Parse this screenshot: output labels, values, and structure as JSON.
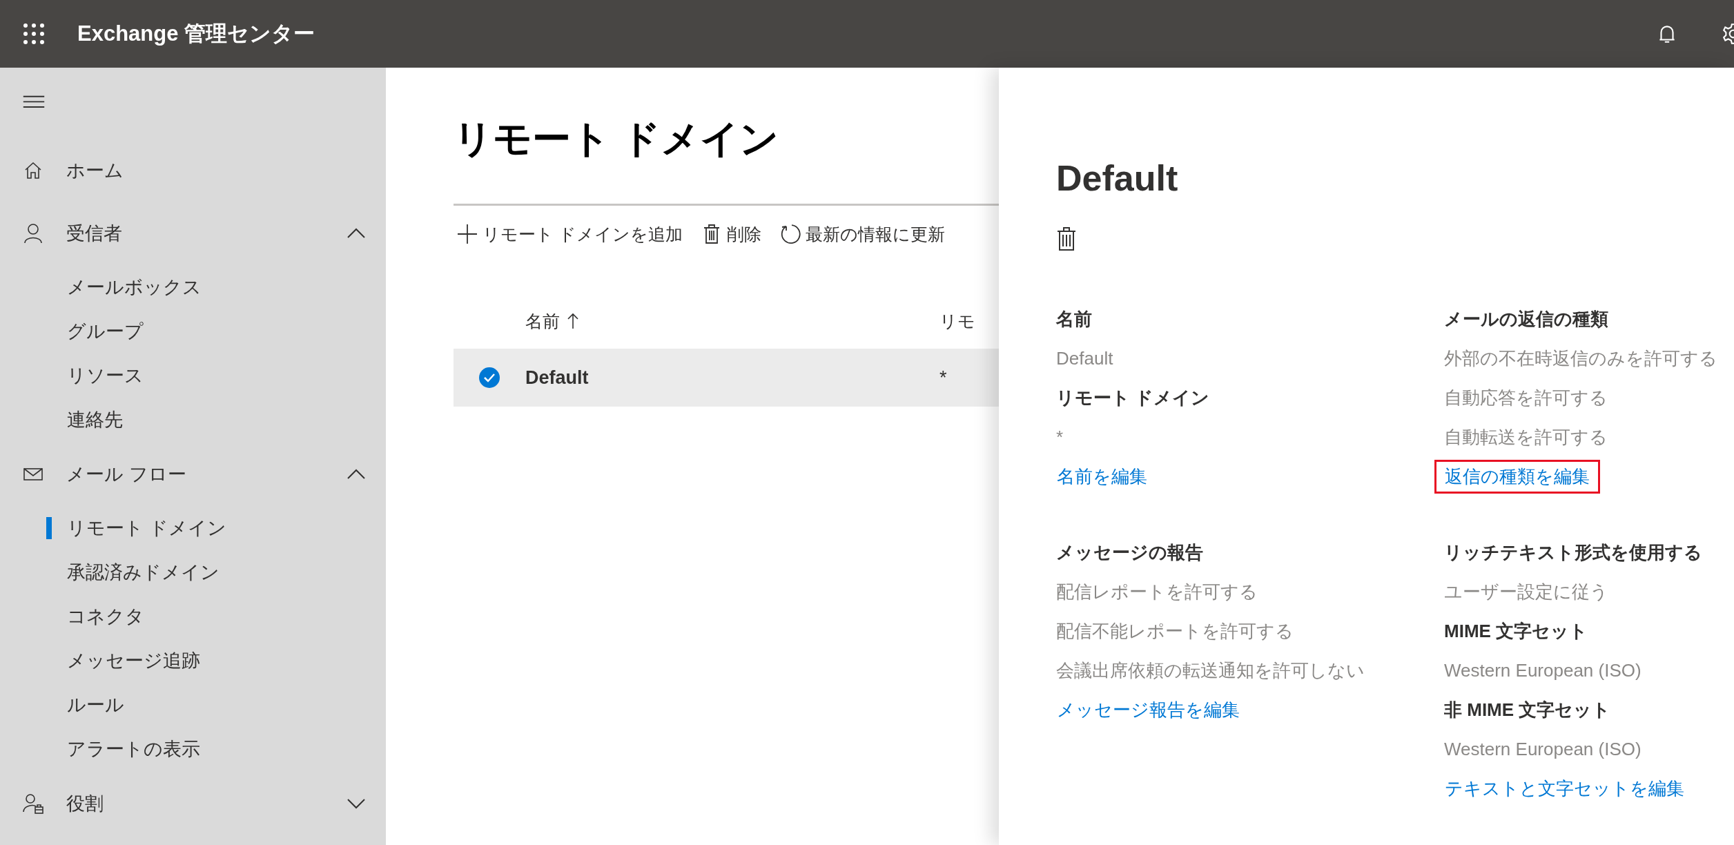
{
  "top_bar": {
    "title": "Exchange 管理センター"
  },
  "sidebar": {
    "items": [
      {
        "label": "ホーム",
        "selected": false
      },
      {
        "label": "受信者",
        "selected": false,
        "expanded": true,
        "children": [
          {
            "label": "メールボックス",
            "selected": false
          },
          {
            "label": "グループ",
            "selected": false
          },
          {
            "label": "リソース",
            "selected": false
          },
          {
            "label": "連絡先",
            "selected": false
          }
        ]
      },
      {
        "label": "メール フロー",
        "selected": false,
        "expanded": true,
        "children": [
          {
            "label": "リモート ドメイン",
            "selected": true
          },
          {
            "label": "承認済みドメイン",
            "selected": false
          },
          {
            "label": "コネクタ",
            "selected": false
          },
          {
            "label": "メッセージ追跡",
            "selected": false
          },
          {
            "label": "ルール",
            "selected": false
          },
          {
            "label": "アラートの表示",
            "selected": false
          }
        ]
      },
      {
        "label": "役割",
        "selected": false,
        "expanded": false
      }
    ]
  },
  "page": {
    "title": "リモート ドメイン",
    "toolbar": [
      "リモート ドメインを追加",
      "削除",
      "最新の情報に更新"
    ],
    "table": {
      "columns": [
        {
          "label": "名前",
          "sorted": true
        },
        {
          "label": "リモ",
          "sorted": false
        }
      ],
      "rows": [
        {
          "cells": [
            "Default",
            "*"
          ],
          "selected": true
        }
      ]
    }
  },
  "panel": {
    "title": "Default",
    "columns": [
      [
        {
          "kind": "heading",
          "text": "名前"
        },
        {
          "kind": "value",
          "text": "Default"
        },
        {
          "kind": "heading",
          "text": "リモート ドメイン"
        },
        {
          "kind": "value",
          "text": "*"
        },
        {
          "kind": "link",
          "text": "名前を編集",
          "highlighted": false
        },
        {
          "kind": "gap"
        },
        {
          "kind": "heading",
          "text": "メッセージの報告"
        },
        {
          "kind": "value",
          "text": "配信レポートを許可する"
        },
        {
          "kind": "value",
          "text": "配信不能レポートを許可する"
        },
        {
          "kind": "value",
          "text": "会議出席依頼の転送通知を許可しない"
        },
        {
          "kind": "link",
          "text": "メッセージ報告を編集",
          "highlighted": false
        }
      ],
      [
        {
          "kind": "heading",
          "text": "メールの返信の種類"
        },
        {
          "kind": "value",
          "text": "外部の不在時返信のみを許可する"
        },
        {
          "kind": "value",
          "text": "自動応答を許可する"
        },
        {
          "kind": "value",
          "text": "自動転送を許可する"
        },
        {
          "kind": "link",
          "text": "返信の種類を編集",
          "highlighted": true
        },
        {
          "kind": "gap"
        },
        {
          "kind": "heading",
          "text": "リッチテキスト形式を使用する"
        },
        {
          "kind": "value",
          "text": "ユーザー設定に従う"
        },
        {
          "kind": "heading",
          "text": "MIME 文字セット"
        },
        {
          "kind": "value",
          "text": "Western European (ISO)"
        },
        {
          "kind": "heading",
          "text": "非 MIME 文字セット"
        },
        {
          "kind": "value",
          "text": "Western European (ISO)"
        },
        {
          "kind": "link",
          "text": "テキストと文字セットを編集",
          "highlighted": false
        }
      ]
    ]
  }
}
